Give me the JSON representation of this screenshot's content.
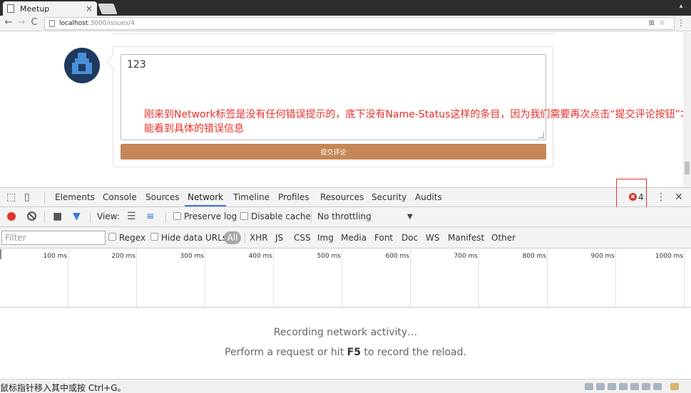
{
  "browser": {
    "tab_title": "Meetup",
    "tab_close": "×",
    "url_host": "localhost",
    "url_path": ":3000/issues/4",
    "back": "←",
    "forward": "→",
    "reload": "C",
    "more": "⋮",
    "window_control": "▴"
  },
  "page": {
    "comment_text": "123",
    "submit_label": "提交评论",
    "annotation": "刚来到Network标签是没有任何错误提示的，底下没有Name-Status这样的条目，因为我们需要再次点击“提交评论按钮”才能看到具体的错误信息"
  },
  "devtools": {
    "tabs": [
      "Elements",
      "Console",
      "Sources",
      "Network",
      "Timeline",
      "Profiles",
      "Resources",
      "Security",
      "Audits"
    ],
    "active_tab": "Network",
    "error_count": "4",
    "error_icon": "✖",
    "more": "⋮",
    "close": "✕",
    "toolbar": {
      "view_label": "View:",
      "preserve_log": "Preserve log",
      "disable_cache": "Disable cache",
      "throttling": "No throttling"
    },
    "filter": {
      "placeholder": "Filter",
      "regex": "Regex",
      "hide_data_urls": "Hide data URLs",
      "types": [
        "All",
        "XHR",
        "JS",
        "CSS",
        "Img",
        "Media",
        "Font",
        "Doc",
        "WS",
        "Manifest",
        "Other"
      ]
    },
    "timeline_labels": [
      "100 ms",
      "200 ms",
      "300 ms",
      "400 ms",
      "500 ms",
      "600 ms",
      "700 ms",
      "800 ms",
      "900 ms",
      "1000 ms"
    ],
    "empty_title": "Recording network activity…",
    "empty_sub_prefix": "Perform a request or hit ",
    "empty_sub_key": "F5",
    "empty_sub_suffix": " to record the reload."
  },
  "statusbar": {
    "text": "鼠标指针移入其中或按 Ctrl+G。"
  }
}
